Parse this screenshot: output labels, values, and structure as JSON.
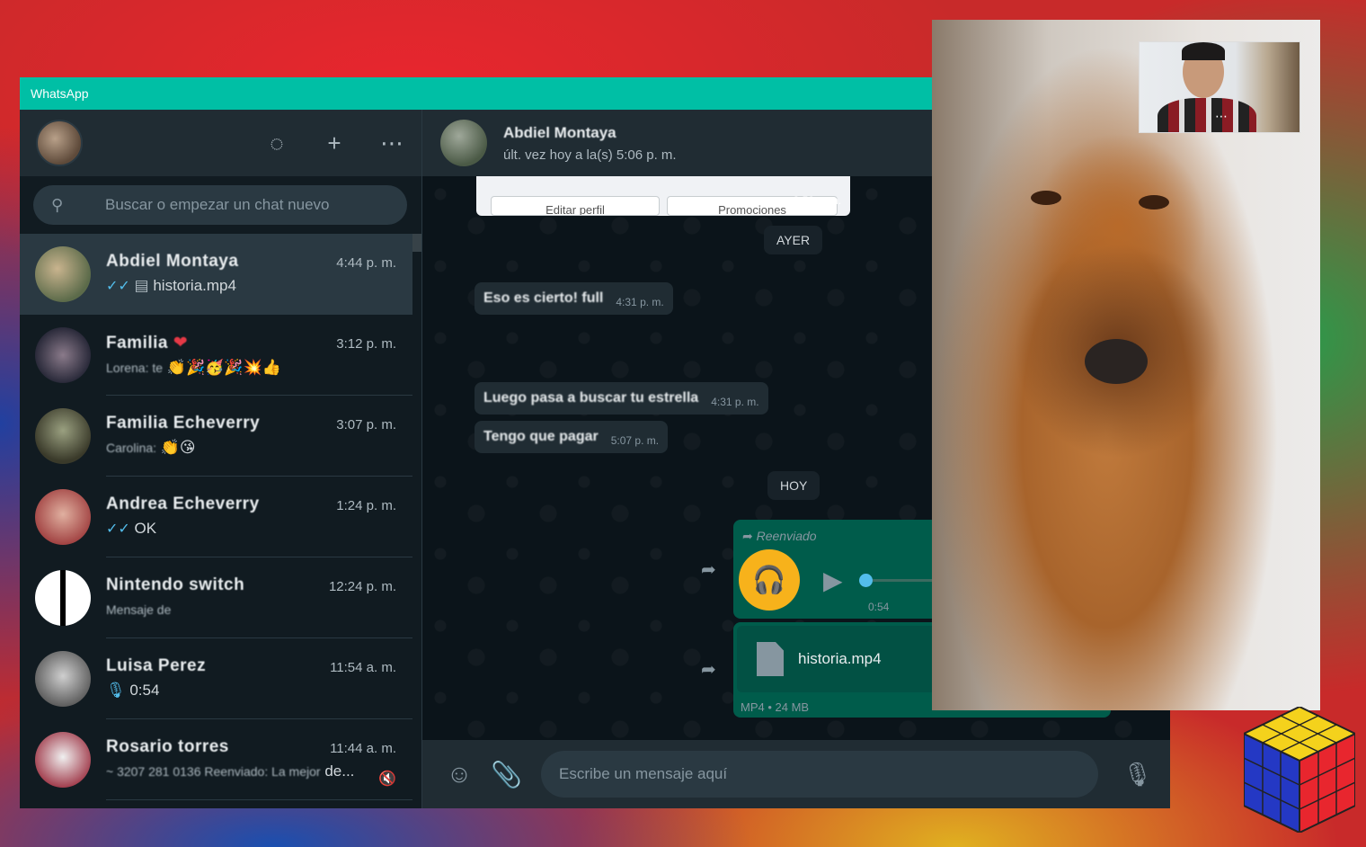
{
  "window": {
    "title": "WhatsApp"
  },
  "sidebar": {
    "icons": [
      "status-icon",
      "new-chat-icon",
      "menu-icon"
    ],
    "search": {
      "placeholder": "Buscar o empezar un chat nuevo"
    },
    "chats": [
      {
        "name": "Abdiel Montaya",
        "time": "4:44 p. m.",
        "tick": "✓✓",
        "attach": "▤",
        "preview": "historia.mp4",
        "active": true
      },
      {
        "name": "Familia",
        "time": "3:12 p. m.",
        "preview_blur": "Lorena: te",
        "emoji": "👏🎉🥳🎉💥👍"
      },
      {
        "name": "Familia Echeverry",
        "time": "3:07 p. m.",
        "preview_blur": "Carolina:",
        "emoji": "👏😘"
      },
      {
        "name": "Andrea Echeverry",
        "time": "1:24 p. m.",
        "tick": "✓✓",
        "preview": "OK"
      },
      {
        "name": "Nintendo switch",
        "time": "12:24 p. m.",
        "preview_blur": "Mensaje de"
      },
      {
        "name": "Luisa Perez",
        "time": "11:54 a. m.",
        "mic": "🎙",
        "preview": "0:54"
      },
      {
        "name": "Rosario torres",
        "time": "11:44 a. m.",
        "preview_blur": "~ 3207 281 0136 Reenviado: La mejor",
        "preview": "de..."
      }
    ]
  },
  "conversation": {
    "name": "Abdiel Montaya",
    "status": "últ. vez hoy a la(s) 5:06 p. m.",
    "card": {
      "btn1": "Editar perfil",
      "btn2": "Promociones",
      "time": "3:52 p. m."
    },
    "dates": {
      "yesterday": "AYER",
      "today": "HOY"
    },
    "messages": [
      {
        "text": "Eso es cierto! full",
        "time": "4:31 p. m."
      },
      {
        "text": "Luego pasa a buscar tu estrella",
        "time": "4:31 p. m."
      },
      {
        "text": "Tengo que pagar",
        "time": "5:07 p. m."
      }
    ],
    "audio": {
      "label": "Reenviado",
      "duration": "0:54",
      "progress": 0
    },
    "file": {
      "name": "historia.mp4",
      "meta": "MP4 • 24 MB"
    },
    "composer": {
      "placeholder": "Escribe un mensaje aquí"
    }
  },
  "colors": {
    "accent": "#00bfa5",
    "outgoing": "#005c4b",
    "incoming": "#202c33",
    "tick": "#53bdeb",
    "audio": "#f7b21b"
  }
}
